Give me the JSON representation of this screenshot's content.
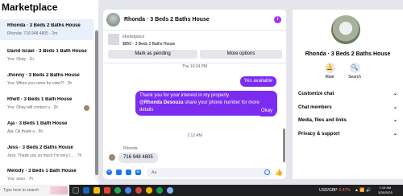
{
  "sidebar": {
    "title": "Marketplace",
    "conversations": [
      {
        "name": "Rhonda · 3 Beds 2 Baths House",
        "sub": "Rhonda: 716 948 4805 · 2m",
        "active": true
      },
      {
        "name": "David Israel · 3 Beds 1 Bath House",
        "sub": "You: Okay · 1h",
        "active": false
      },
      {
        "name": "Jhonny · 3 Beds 2 Baths House",
        "sub": "You: When you come for view?! · 2h",
        "active": false
      },
      {
        "name": "Rhett · 3 Beds 1 Bath House",
        "sub": "You: Okay will contact u · 2h",
        "active": false
      },
      {
        "name": "Aja · 3 Beds 1 Bath House",
        "sub": "Aja: Ok thank u · 5h",
        "active": false
      },
      {
        "name": "Jess · 3 Beds 2 Baths House",
        "sub": "Jess: Thank you so much I'm very I... · 7h",
        "active": false
      },
      {
        "name": "Melody · 3 Beds 1 Bath House",
        "sub": "You: soon · 7h",
        "active": false
      }
    ]
  },
  "chat": {
    "title": "Rhonda · 3 Beds 2 Baths House",
    "info_icon": "info-icon",
    "listing_label": "Marketplace",
    "listing_price": "$850 · 3 Beds 2 Baths House",
    "mark_pending": "Mark as pending",
    "more_options": "More options",
    "time1": "Thu 10:24 PM",
    "msg_yes": "Yes available",
    "msg_long_1": "Thank you for your interest in my property.",
    "msg_long_mention": "@Rhonda Desouza",
    "msg_long_2": " share your phone number for more details",
    "msg_okay": "Okay",
    "time2": "1:12 AM",
    "received_name": "Rhonda",
    "received_msg": "716 948 4805",
    "input_placeholder": "Aa"
  },
  "details": {
    "title": "Rhonda · 3 Beds 2 Baths House",
    "mute": "Mute",
    "search": "Search",
    "menu": [
      "Customize chat",
      "Chat members",
      "Media, files and links",
      "Privacy & support"
    ]
  },
  "taskbar": {
    "search_placeholder": "Type here to search",
    "ticker": "USD/GBP",
    "ticker_change": "-0.47%",
    "time": "1:15 AM",
    "date": "3/28/2025"
  },
  "colors": {
    "accent": "#7b2cf0",
    "brand": "#1877f2"
  }
}
